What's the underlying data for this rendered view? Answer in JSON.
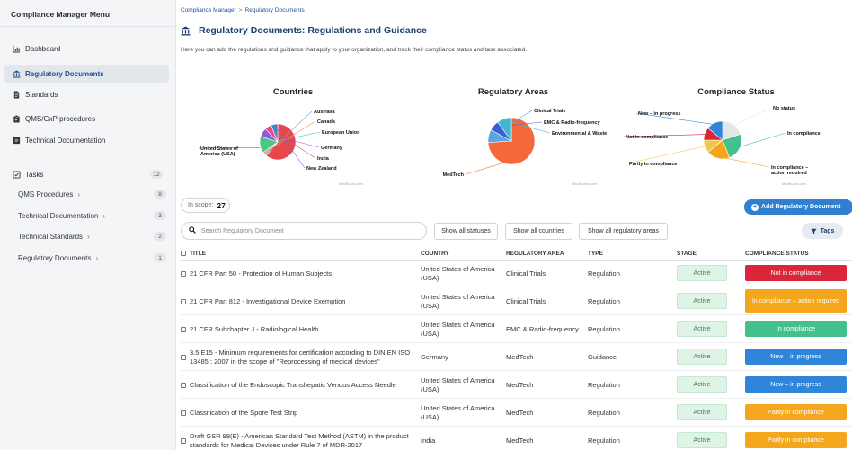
{
  "colors": {
    "accent": "#2f80d0",
    "red": "#d9263a",
    "orange": "#f4a61d",
    "green": "#44c08a",
    "blue": "#2f86d8",
    "stage_bg": "#dff3e6"
  },
  "sidebar": {
    "heading": "Compliance Manager Menu",
    "items": [
      {
        "label": "Dashboard",
        "icon": "bar-chart-icon"
      },
      {
        "label": "Regulatory Documents",
        "icon": "bank-icon",
        "active": true
      },
      {
        "label": "Standards",
        "icon": "document-icon"
      },
      {
        "label": "QMS/GxP procedures",
        "icon": "clipboard-icon"
      },
      {
        "label": "Technical Documentation",
        "icon": "book-icon"
      },
      {
        "label": "Tasks",
        "icon": "checkbox-icon",
        "count": "12"
      }
    ],
    "task_subitems": [
      {
        "label": "QMS Procedures",
        "count": "8"
      },
      {
        "label": "Technical Documentation",
        "count": "3"
      },
      {
        "label": "Technical Standards",
        "count": "2"
      },
      {
        "label": "Regulatory Documents",
        "count": "1"
      }
    ]
  },
  "breadcrumb": {
    "root": "Compliance Manager",
    "separator": ">",
    "current": "Regulatory Documents"
  },
  "page": {
    "title": "Regulatory Documents: Regulations and Guidance",
    "intro": "Here you can add the regulations and guidance that apply to your organization, and track their compliance status and task associated."
  },
  "chart_data": [
    {
      "type": "pie",
      "title": "Countries",
      "slices": [
        {
          "label": "United States of America (USA)",
          "value": 61,
          "color": "#e8464c"
        },
        {
          "label": "Australia",
          "value": 2,
          "color": "#6aa1e3"
        },
        {
          "label": "Canada",
          "value": 2,
          "color": "#f09a3e"
        },
        {
          "label": "European Union",
          "value": 15,
          "color": "#4cc687"
        },
        {
          "label": "Germany",
          "value": 8,
          "color": "#8e5bd6"
        },
        {
          "label": "India",
          "value": 6,
          "color": "#e0507b"
        },
        {
          "label": "New Zealand",
          "value": 6,
          "color": "#4b7fd2"
        }
      ],
      "watermark": "MedBoard.com"
    },
    {
      "type": "pie",
      "title": "Regulatory Areas",
      "slices": [
        {
          "label": "MedTech",
          "value": 74,
          "color": "#f4683a"
        },
        {
          "label": "Clinical Trials",
          "value": 9,
          "color": "#5aa5e6"
        },
        {
          "label": "EMC & Radio-frequency",
          "value": 7,
          "color": "#3b5ed0"
        },
        {
          "label": "Environmental & Waste",
          "value": 10,
          "color": "#41b7d1"
        }
      ],
      "watermark": "MedBoard.com"
    },
    {
      "type": "pie",
      "title": "Compliance Status",
      "slices": [
        {
          "label": "No status",
          "value": 20,
          "color": "#e5e5e5"
        },
        {
          "label": "In compliance",
          "value": 24,
          "color": "#44c08a"
        },
        {
          "label": "In compliance – action required",
          "value": 20,
          "color": "#f4a61d"
        },
        {
          "label": "Partly in compliance",
          "value": 11,
          "color": "#f3c84a"
        },
        {
          "label": "Not in compliance",
          "value": 11,
          "color": "#d9263a"
        },
        {
          "label": "New – in progress",
          "value": 14,
          "color": "#2f86d8"
        }
      ],
      "watermark": "MedBoard.com"
    }
  ],
  "toolbar": {
    "in_scope_label": "In scope:",
    "in_scope_count": "27",
    "add_button": "Add Regulatory Document",
    "search_placeholder": "Search Regulatory Document",
    "filter_status": "Show all statuses",
    "filter_countries": "Show all countries",
    "filter_areas": "Show all regulatory areas",
    "tags_button": "Tags"
  },
  "table": {
    "columns": {
      "title": "TITLE ↑",
      "country": "COUNTRY",
      "area": "REGULATORY AREA",
      "type": "TYPE",
      "stage": "STAGE",
      "status": "COMPLIANCE STATUS"
    },
    "rows": [
      {
        "title": "21 CFR Part 50 - Protection of Human Subjects",
        "country": "United States of America (USA)",
        "area": "Clinical Trials",
        "type": "Regulation",
        "stage": "Active",
        "status": "Not in compliance",
        "status_color": "#d9263a"
      },
      {
        "title": "21 CFR Part 812 - Investigational Device Exemption",
        "country": "United States of America (USA)",
        "area": "Clinical Trials",
        "type": "Regulation",
        "stage": "Active",
        "status": "In compliance – action required",
        "status_color": "#f4a61d"
      },
      {
        "title": "21 CFR Subchapter J - Radiological Health",
        "country": "United States of America (USA)",
        "area": "EMC & Radio-frequency",
        "type": "Regulation",
        "stage": "Active",
        "status": "In compliance",
        "status_color": "#44c08a"
      },
      {
        "title": "3.5 E15 - Minimum requirements for certification according to DIN EN ISO 13485 : 2007 in the scope of \"Reprocessing of medical devices\"",
        "country": "Germany",
        "area": "MedTech",
        "type": "Guidance",
        "stage": "Active",
        "status": "New – in progress",
        "status_color": "#2f86d8"
      },
      {
        "title": "Classification of the Endoscopic Transhepatic Venous Access Needle",
        "country": "United States of America (USA)",
        "area": "MedTech",
        "type": "Regulation",
        "stage": "Active",
        "status": "New – in progress",
        "status_color": "#2f86d8"
      },
      {
        "title": "Classification of the Spore Test Strip",
        "country": "United States of America (USA)",
        "area": "MedTech",
        "type": "Regulation",
        "stage": "Active",
        "status": "Partly in compliance",
        "status_color": "#f4a61d"
      },
      {
        "title": "Draft GSR 98(E) - American Standard Test Method (ASTM) in the product standards for Medical Devices under Rule 7 of MDR-2017",
        "country": "India",
        "area": "MedTech",
        "type": "Regulation",
        "stage": "Active",
        "status": "Partly in compliance",
        "status_color": "#f4a61d"
      }
    ]
  }
}
